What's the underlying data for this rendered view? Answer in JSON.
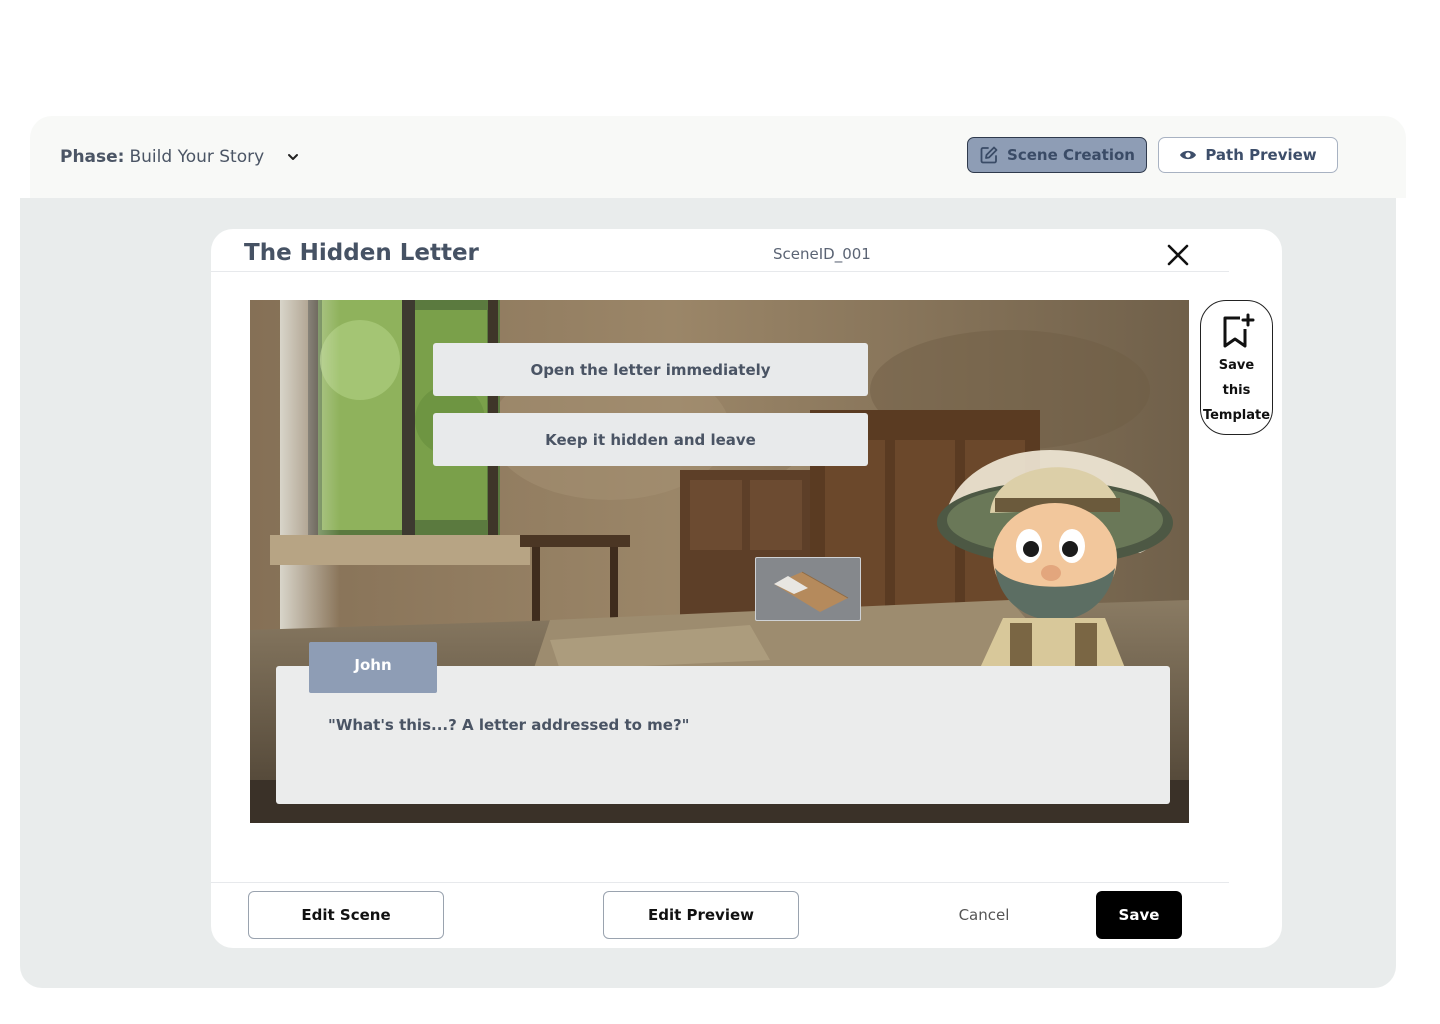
{
  "phase": {
    "label": "Phase:",
    "value": "Build Your Story"
  },
  "mode_toggle": {
    "scene_creation": "Scene Creation",
    "path_preview": "Path Preview",
    "active": "scene_creation"
  },
  "modal": {
    "title": "The Hidden Letter",
    "scene_id": "SceneID_001",
    "choices": [
      "Open the letter immediately",
      "Keep it hidden and leave"
    ],
    "dialog": {
      "speaker": "John",
      "line": "\"What's this...? A letter addressed to me?\""
    },
    "save_template": {
      "line1": "Save",
      "line2": "this",
      "line3": "Template"
    },
    "footer": {
      "edit_scene": "Edit Scene",
      "edit_preview": "Edit Preview",
      "cancel": "Cancel",
      "save": "Save"
    }
  },
  "colors": {
    "accent": "#8e9db5",
    "workspace": "#e9ecec",
    "primary_button": "#000000"
  },
  "icons": {
    "phase_dropdown": "chevron-down-icon",
    "scene_creation": "edit-icon",
    "path_preview": "eye-icon",
    "close": "close-icon",
    "save_template": "bookmark-plus-icon"
  }
}
